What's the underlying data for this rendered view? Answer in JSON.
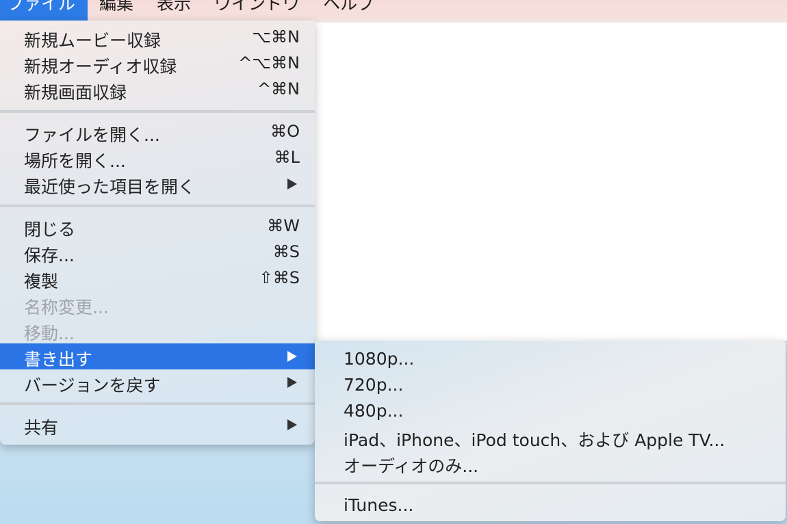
{
  "menubar": {
    "items": [
      {
        "label": "ファイル",
        "active": true
      },
      {
        "label": "編集"
      },
      {
        "label": "表示"
      },
      {
        "label": "ウインドウ"
      },
      {
        "label": "ヘルプ"
      }
    ]
  },
  "file_menu": {
    "new_movie": {
      "label": "新規ムービー収録",
      "shortcut": "⌥⌘N"
    },
    "new_audio": {
      "label": "新規オーディオ収録",
      "shortcut": "^⌥⌘N"
    },
    "new_screen": {
      "label": "新規画面収録",
      "shortcut": "^⌘N"
    },
    "open_file": {
      "label": "ファイルを開く...",
      "shortcut": "⌘O"
    },
    "open_location": {
      "label": "場所を開く...",
      "shortcut": "⌘L"
    },
    "open_recent": {
      "label": "最近使った項目を開く"
    },
    "close": {
      "label": "閉じる",
      "shortcut": "⌘W"
    },
    "save": {
      "label": "保存...",
      "shortcut": "⌘S"
    },
    "duplicate": {
      "label": "複製",
      "shortcut": "⇧⌘S"
    },
    "rename": {
      "label": "名称変更..."
    },
    "move": {
      "label": "移動..."
    },
    "export": {
      "label": "書き出す"
    },
    "revert": {
      "label": "バージョンを戻す"
    },
    "share": {
      "label": "共有"
    }
  },
  "export_submenu": {
    "items": [
      {
        "label": "1080p..."
      },
      {
        "label": "720p..."
      },
      {
        "label": "480p..."
      },
      {
        "label": "iPad、iPhone、iPod touch、および Apple TV..."
      },
      {
        "label": "オーディオのみ..."
      },
      {
        "label": "iTunes..."
      }
    ]
  },
  "colors": {
    "accent": "#2b74e5",
    "disabled_text": "#a0a4a8"
  }
}
